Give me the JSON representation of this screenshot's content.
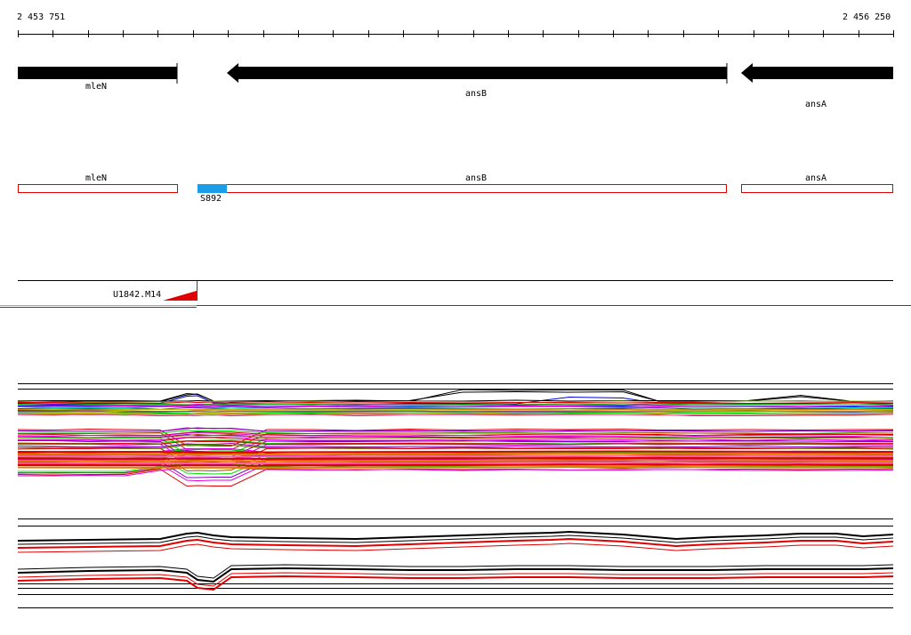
{
  "ruler": {
    "start_label": "2 453 751",
    "end_label": "2 456 250"
  },
  "gene_track": {
    "genes": [
      {
        "name": "mleN",
        "direction": "right"
      },
      {
        "name": "ansB",
        "direction": "left"
      },
      {
        "name": "ansA",
        "direction": "left"
      }
    ]
  },
  "annotation_track": {
    "features": [
      {
        "name": "mleN"
      },
      {
        "name": "ansB"
      },
      {
        "name": "ansA"
      }
    ],
    "marker": {
      "label": "S892",
      "color": "#1a9ee8"
    }
  },
  "probe_track": {
    "probe_label": "U1842.M14",
    "color": "#e00000"
  },
  "colors": {
    "gene_arrow": "#000000",
    "feature_outline": "#e00000",
    "accent": "#e00000"
  }
}
